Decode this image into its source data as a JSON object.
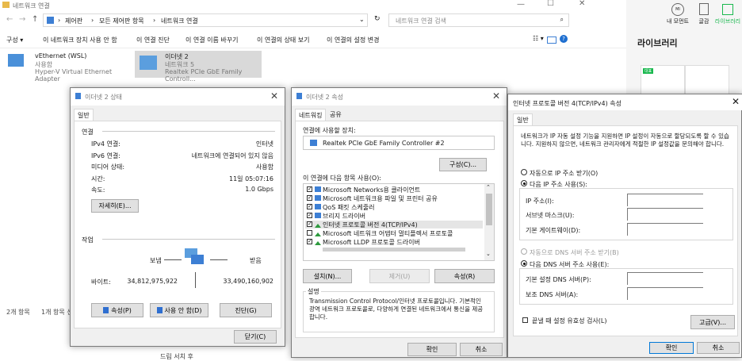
{
  "explorer": {
    "title": "네트워크 연결",
    "breadcrumb": [
      "제어판",
      "모든 제어판 항목",
      "네트워크 연결"
    ],
    "search_placeholder": "네트워크 연결 검색",
    "commands": [
      "구성 ▾",
      "이 네트워크 장치 사용 안 함",
      "이 연결 진단",
      "이 연결 이름 바꾸기",
      "이 연결의 상태 보기",
      "이 연결의 설정 변경"
    ],
    "adapters": [
      {
        "name": "vEthernet (WSL)",
        "status": "사용함",
        "device": "Hyper-V Virtual Ethernet Adapter"
      },
      {
        "name": "이더넷 2",
        "status": "네트워크 5",
        "device": "Realtek PCIe GbE Family Controll..."
      }
    ],
    "statusbar": [
      "2개 항목",
      "1개 항목 선"
    ]
  },
  "right_app": {
    "nav": [
      {
        "label": "내 모먼트",
        "icon": "moment-icon"
      },
      {
        "label": "글감",
        "icon": "document-icon"
      },
      {
        "label": "라이브러리",
        "icon": "library-icon"
      }
    ],
    "library_title": "라이브러리",
    "thumb_badge": "대표"
  },
  "status_dialog": {
    "title": "이더넷 2 상태",
    "tab": "일반",
    "connection_header": "연결",
    "rows": [
      {
        "label": "IPv4 연결:",
        "value": "인터넷"
      },
      {
        "label": "IPv6 연결:",
        "value": "네트워크에 연결되어 있지 않음"
      },
      {
        "label": "미디어 상태:",
        "value": "사용함"
      },
      {
        "label": "시간:",
        "value": "11일 05:07:16"
      },
      {
        "label": "속도:",
        "value": "1.0 Gbps"
      }
    ],
    "details_button": "자세히(E)...",
    "activity_header": "작업",
    "sent_label": "보냄",
    "received_label": "받음",
    "bytes_label": "바이트:",
    "bytes_sent": "34,812,975,922",
    "bytes_received": "33,490,160,902",
    "properties_button": "속성(P)",
    "disable_button": "사용 안 함(D)",
    "diagnose_button": "진단(G)",
    "close_button": "닫기(C)"
  },
  "properties_dialog": {
    "title": "이더넷 2 속성",
    "tabs": [
      "네트워킹",
      "공유"
    ],
    "connect_using_label": "연결에 사용할 장치:",
    "device_name": "Realtek PCIe GbE Family Controller #2",
    "configure_button": "구성(C)...",
    "items_label": "이 연결에 다음 항목 사용(O):",
    "items": [
      {
        "label": "Microsoft Networks용 클라이언트",
        "checked": true
      },
      {
        "label": "Microsoft 네트워크용 파일 및 프린터 공유",
        "checked": true
      },
      {
        "label": "QoS 패킷 스케줄러",
        "checked": true
      },
      {
        "label": "브리지 드라이버",
        "checked": true
      },
      {
        "label": "인터넷 프로토콜 버전 4(TCP/IPv4)",
        "checked": true
      },
      {
        "label": "Microsoft 네트워크 어댑터 멀티플렉서 프로토콜",
        "checked": false
      },
      {
        "label": "Microsoft LLDP 프로토콜 드라이버",
        "checked": true
      }
    ],
    "install_button": "설치(N)...",
    "uninstall_button": "제거(U)",
    "properties_button": "속성(R)",
    "description_header": "설명",
    "description": "Transmission Control Protocol/인터넷 프로토콜입니다. 기본적인 광역 네트워크 프로토콜로, 다양하게 연결된 네트워크에서 통신을 제공합니다.",
    "ok_button": "확인",
    "cancel_button": "취소"
  },
  "ipv4_dialog": {
    "title": "인터넷 프로토콜 버전 4(TCP/IPv4) 속성",
    "tab": "일반",
    "intro": "네트워크가 IP 자동 설정 기능을 지원하면 IP 설정이 자동으로 할당되도록 할 수 있습니다. 지원하지 않으면, 네트워크 관리자에게 적절한 IP 설정값을 문의해야 합니다.",
    "auto_ip": "자동으로 IP 주소 받기(O)",
    "manual_ip": "다음 IP 주소 사용(S):",
    "ip_label": "IP 주소(I):",
    "subnet_label": "서브넷 마스크(U):",
    "gateway_label": "기본 게이트웨이(D):",
    "auto_dns": "자동으로 DNS 서버 주소 받기(B)",
    "manual_dns": "다음 DNS 서버 주소 사용(E):",
    "preferred_dns_label": "기본 설정 DNS 서버(P):",
    "alternate_dns_label": "보조 DNS 서버(A):",
    "validate_label": "끝낼 때 설정 유효성 검사(L)",
    "advanced_button": "고급(V)...",
    "ok_button": "확인",
    "cancel_button": "취소"
  },
  "background_snippet": "드림 서치 후"
}
